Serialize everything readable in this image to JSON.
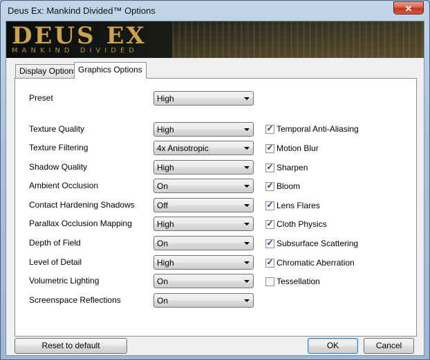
{
  "window": {
    "title": "Deus Ex: Mankind Divided™ Options",
    "close_label": "✕"
  },
  "banner": {
    "logo_main": "DEUS EX",
    "logo_sub": "MANKIND DIVIDED"
  },
  "tabs": [
    {
      "label": "Display Options"
    },
    {
      "label": "Graphics Options"
    }
  ],
  "graphics": {
    "preset": {
      "label": "Preset",
      "value": "High"
    },
    "settings": [
      {
        "label": "Texture Quality",
        "value": "High"
      },
      {
        "label": "Texture Filtering",
        "value": "4x Anisotropic"
      },
      {
        "label": "Shadow Quality",
        "value": "High"
      },
      {
        "label": "Ambient Occlusion",
        "value": "On"
      },
      {
        "label": "Contact Hardening Shadows",
        "value": "Off"
      },
      {
        "label": "Parallax Occlusion Mapping",
        "value": "High"
      },
      {
        "label": "Depth of Field",
        "value": "On"
      },
      {
        "label": "Level of Detail",
        "value": "High"
      },
      {
        "label": "Volumetric Lighting",
        "value": "On"
      },
      {
        "label": "Screenspace Reflections",
        "value": "On"
      }
    ],
    "toggles": [
      {
        "label": "Temporal Anti-Aliasing",
        "checked": true
      },
      {
        "label": "Motion Blur",
        "checked": true
      },
      {
        "label": "Sharpen",
        "checked": true
      },
      {
        "label": "Bloom",
        "checked": true
      },
      {
        "label": "Lens Flares",
        "checked": true
      },
      {
        "label": "Cloth Physics",
        "checked": true
      },
      {
        "label": "Subsurface Scattering",
        "checked": true
      },
      {
        "label": "Chromatic Aberration",
        "checked": true
      },
      {
        "label": "Tessellation",
        "checked": false
      }
    ]
  },
  "buttons": {
    "reset": "Reset to default",
    "ok": "OK",
    "cancel": "Cancel"
  },
  "check_glyph": "✓"
}
